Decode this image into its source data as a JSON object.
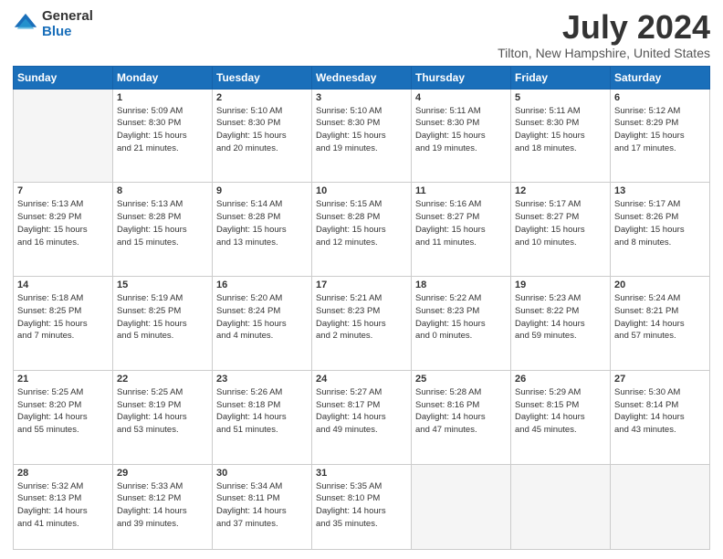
{
  "logo": {
    "general": "General",
    "blue": "Blue"
  },
  "header": {
    "month": "July 2024",
    "location": "Tilton, New Hampshire, United States"
  },
  "weekdays": [
    "Sunday",
    "Monday",
    "Tuesday",
    "Wednesday",
    "Thursday",
    "Friday",
    "Saturday"
  ],
  "weeks": [
    [
      {
        "day": "",
        "info": ""
      },
      {
        "day": "1",
        "info": "Sunrise: 5:09 AM\nSunset: 8:30 PM\nDaylight: 15 hours\nand 21 minutes."
      },
      {
        "day": "2",
        "info": "Sunrise: 5:10 AM\nSunset: 8:30 PM\nDaylight: 15 hours\nand 20 minutes."
      },
      {
        "day": "3",
        "info": "Sunrise: 5:10 AM\nSunset: 8:30 PM\nDaylight: 15 hours\nand 19 minutes."
      },
      {
        "day": "4",
        "info": "Sunrise: 5:11 AM\nSunset: 8:30 PM\nDaylight: 15 hours\nand 19 minutes."
      },
      {
        "day": "5",
        "info": "Sunrise: 5:11 AM\nSunset: 8:30 PM\nDaylight: 15 hours\nand 18 minutes."
      },
      {
        "day": "6",
        "info": "Sunrise: 5:12 AM\nSunset: 8:29 PM\nDaylight: 15 hours\nand 17 minutes."
      }
    ],
    [
      {
        "day": "7",
        "info": "Sunrise: 5:13 AM\nSunset: 8:29 PM\nDaylight: 15 hours\nand 16 minutes."
      },
      {
        "day": "8",
        "info": "Sunrise: 5:13 AM\nSunset: 8:28 PM\nDaylight: 15 hours\nand 15 minutes."
      },
      {
        "day": "9",
        "info": "Sunrise: 5:14 AM\nSunset: 8:28 PM\nDaylight: 15 hours\nand 13 minutes."
      },
      {
        "day": "10",
        "info": "Sunrise: 5:15 AM\nSunset: 8:28 PM\nDaylight: 15 hours\nand 12 minutes."
      },
      {
        "day": "11",
        "info": "Sunrise: 5:16 AM\nSunset: 8:27 PM\nDaylight: 15 hours\nand 11 minutes."
      },
      {
        "day": "12",
        "info": "Sunrise: 5:17 AM\nSunset: 8:27 PM\nDaylight: 15 hours\nand 10 minutes."
      },
      {
        "day": "13",
        "info": "Sunrise: 5:17 AM\nSunset: 8:26 PM\nDaylight: 15 hours\nand 8 minutes."
      }
    ],
    [
      {
        "day": "14",
        "info": "Sunrise: 5:18 AM\nSunset: 8:25 PM\nDaylight: 15 hours\nand 7 minutes."
      },
      {
        "day": "15",
        "info": "Sunrise: 5:19 AM\nSunset: 8:25 PM\nDaylight: 15 hours\nand 5 minutes."
      },
      {
        "day": "16",
        "info": "Sunrise: 5:20 AM\nSunset: 8:24 PM\nDaylight: 15 hours\nand 4 minutes."
      },
      {
        "day": "17",
        "info": "Sunrise: 5:21 AM\nSunset: 8:23 PM\nDaylight: 15 hours\nand 2 minutes."
      },
      {
        "day": "18",
        "info": "Sunrise: 5:22 AM\nSunset: 8:23 PM\nDaylight: 15 hours\nand 0 minutes."
      },
      {
        "day": "19",
        "info": "Sunrise: 5:23 AM\nSunset: 8:22 PM\nDaylight: 14 hours\nand 59 minutes."
      },
      {
        "day": "20",
        "info": "Sunrise: 5:24 AM\nSunset: 8:21 PM\nDaylight: 14 hours\nand 57 minutes."
      }
    ],
    [
      {
        "day": "21",
        "info": "Sunrise: 5:25 AM\nSunset: 8:20 PM\nDaylight: 14 hours\nand 55 minutes."
      },
      {
        "day": "22",
        "info": "Sunrise: 5:25 AM\nSunset: 8:19 PM\nDaylight: 14 hours\nand 53 minutes."
      },
      {
        "day": "23",
        "info": "Sunrise: 5:26 AM\nSunset: 8:18 PM\nDaylight: 14 hours\nand 51 minutes."
      },
      {
        "day": "24",
        "info": "Sunrise: 5:27 AM\nSunset: 8:17 PM\nDaylight: 14 hours\nand 49 minutes."
      },
      {
        "day": "25",
        "info": "Sunrise: 5:28 AM\nSunset: 8:16 PM\nDaylight: 14 hours\nand 47 minutes."
      },
      {
        "day": "26",
        "info": "Sunrise: 5:29 AM\nSunset: 8:15 PM\nDaylight: 14 hours\nand 45 minutes."
      },
      {
        "day": "27",
        "info": "Sunrise: 5:30 AM\nSunset: 8:14 PM\nDaylight: 14 hours\nand 43 minutes."
      }
    ],
    [
      {
        "day": "28",
        "info": "Sunrise: 5:32 AM\nSunset: 8:13 PM\nDaylight: 14 hours\nand 41 minutes."
      },
      {
        "day": "29",
        "info": "Sunrise: 5:33 AM\nSunset: 8:12 PM\nDaylight: 14 hours\nand 39 minutes."
      },
      {
        "day": "30",
        "info": "Sunrise: 5:34 AM\nSunset: 8:11 PM\nDaylight: 14 hours\nand 37 minutes."
      },
      {
        "day": "31",
        "info": "Sunrise: 5:35 AM\nSunset: 8:10 PM\nDaylight: 14 hours\nand 35 minutes."
      },
      {
        "day": "",
        "info": ""
      },
      {
        "day": "",
        "info": ""
      },
      {
        "day": "",
        "info": ""
      }
    ]
  ]
}
